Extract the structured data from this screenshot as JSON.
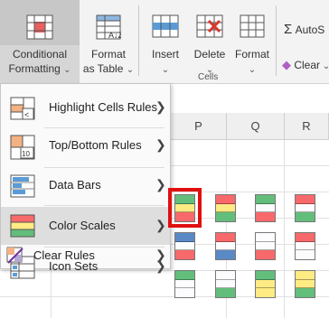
{
  "ribbon": {
    "conditional_formatting": {
      "line1": "Conditional",
      "line2": "Formatting"
    },
    "format_as_table": {
      "line1": "Format",
      "line2": "as Table"
    },
    "insert": {
      "label": "Insert"
    },
    "delete": {
      "label": "Delete"
    },
    "format": {
      "label": "Format"
    },
    "cells_group_label": "Cells",
    "autosum": {
      "label": "AutoS"
    },
    "clear": {
      "label": "Clear"
    }
  },
  "sheet": {
    "columns": [
      "P",
      "Q",
      "R"
    ]
  },
  "menu": {
    "items": [
      {
        "label": "Highlight Cells Rules",
        "icon": "highlight-cells-icon"
      },
      {
        "label": "Top/Bottom Rules",
        "icon": "top-bottom-icon"
      },
      {
        "label": "Data Bars",
        "icon": "data-bars-icon"
      },
      {
        "label": "Color Scales",
        "icon": "color-scales-icon"
      },
      {
        "label": "Icon Sets",
        "icon": "icon-sets-icon"
      },
      {
        "label": "Clear Rules",
        "icon": "clear-rules-icon"
      }
    ]
  },
  "color_scales": [
    [
      "#63be7b",
      "#ffeb84",
      "#f8696b"
    ],
    [
      "#f8696b",
      "#ffeb84",
      "#63be7b"
    ],
    [
      "#63be7b",
      "#fcfcff",
      "#f8696b"
    ],
    [
      "#f8696b",
      "#fcfcff",
      "#63be7b"
    ],
    [
      "#5a8ac6",
      "#fcfcff",
      "#f8696b"
    ],
    [
      "#f8696b",
      "#fcfcff",
      "#5a8ac6"
    ],
    [
      "#fcfcff",
      "#fcfcff",
      "#f8696b"
    ],
    [
      "#f8696b",
      "#fcfcff",
      "#fcfcff"
    ],
    [
      "#63be7b",
      "#fcfcff",
      "#fcfcff"
    ],
    [
      "#fcfcff",
      "#fcfcff",
      "#63be7b"
    ],
    [
      "#63be7b",
      "#ffeb84",
      "#ffeb84"
    ],
    [
      "#ffeb84",
      "#ffeb84",
      "#63be7b"
    ]
  ],
  "colors": {
    "accent": "#217346",
    "selection": "#e01010"
  }
}
